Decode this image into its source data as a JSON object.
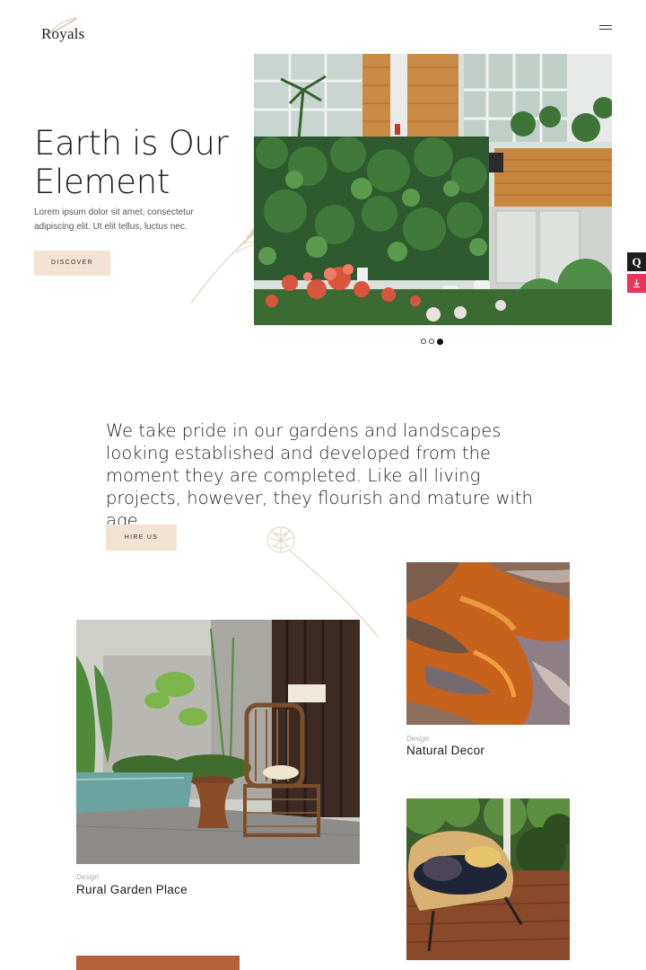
{
  "brand": {
    "logo_text": "Royals"
  },
  "header": {
    "menu_icon": "hamburger-icon"
  },
  "hero": {
    "title_line1": "Earth is Our",
    "title_line2": "Element",
    "subtitle": "Lorem ipsum dolor sit amet, consectetur adipiscing elit. Ut elit tellus, luctus nec.",
    "cta_label": "DISCOVER",
    "slider": {
      "slides": 3,
      "active": 3
    }
  },
  "side_tools": {
    "top_label": "Q",
    "top_icon": "qode-icon",
    "bottom_icon": "download-icon"
  },
  "intro": {
    "text": "We take pride in our gardens and landscapes looking established and developed from the moment they are completed. Like all living projects, however, they flourish and mature with age.",
    "cta_label": "HIRE US"
  },
  "projects": [
    {
      "category": "Design",
      "title": "Natural Decor"
    },
    {
      "category": "Design",
      "title": "Rural Garden Place"
    },
    {
      "category": "",
      "title": ""
    }
  ],
  "colors": {
    "accent_beige": "#f3e3d3",
    "terracotta": "#b5613c",
    "download_red": "#e7365a"
  }
}
